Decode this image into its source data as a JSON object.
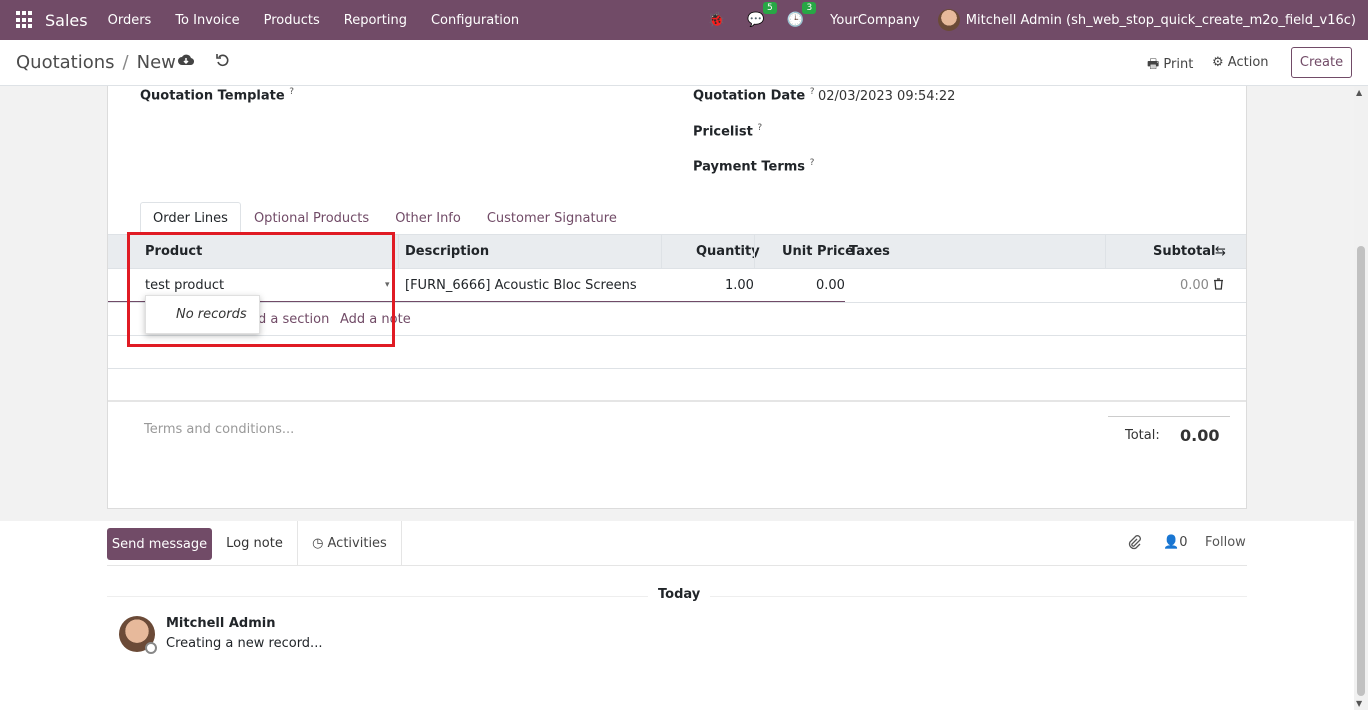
{
  "navbar": {
    "app_name": "Sales",
    "menus": [
      "Orders",
      "To Invoice",
      "Products",
      "Reporting",
      "Configuration"
    ],
    "messages_count": "5",
    "activities_count": "3",
    "company": "YourCompany",
    "user": "Mitchell Admin (sh_web_stop_quick_create_m2o_field_v16c)"
  },
  "control_panel": {
    "breadcrumb_parent": "Quotations",
    "breadcrumb_current": "New",
    "print_label": "Print",
    "action_label": "Action",
    "create_label": "Create"
  },
  "form": {
    "quotation_template_label": "Quotation Template",
    "quotation_date_label": "Quotation Date",
    "quotation_date_value": "02/03/2023 09:54:22",
    "pricelist_label": "Pricelist",
    "payment_terms_label": "Payment Terms",
    "help_mark": "?"
  },
  "tabs": [
    "Order Lines",
    "Optional Products",
    "Other Info",
    "Customer Signature"
  ],
  "order_lines": {
    "headers": {
      "product": "Product",
      "description": "Description",
      "quantity": "Quantity",
      "unit_price": "Unit Price",
      "taxes": "Taxes",
      "subtotal": "Subtotal"
    },
    "row": {
      "product": "test product",
      "description": "[FURN_6666] Acoustic Bloc Screens",
      "quantity": "1.00",
      "unit_price": "0.00",
      "subtotal": "0.00"
    },
    "add_section": "d a section",
    "add_note": "Add a note",
    "dropdown_text": "No records"
  },
  "footer": {
    "terms_placeholder": "Terms and conditions...",
    "total_label": "Total:",
    "total_value": "0.00"
  },
  "chatter": {
    "send_message": "Send message",
    "log_note": "Log note",
    "activities": "Activities",
    "followers_count": "0",
    "follow": "Follow",
    "date_separator": "Today",
    "message_author": "Mitchell Admin",
    "message_body": "Creating a new record..."
  },
  "colors": {
    "brand": "#714b67",
    "highlight": "#e01b24",
    "badge": "#28a745"
  }
}
